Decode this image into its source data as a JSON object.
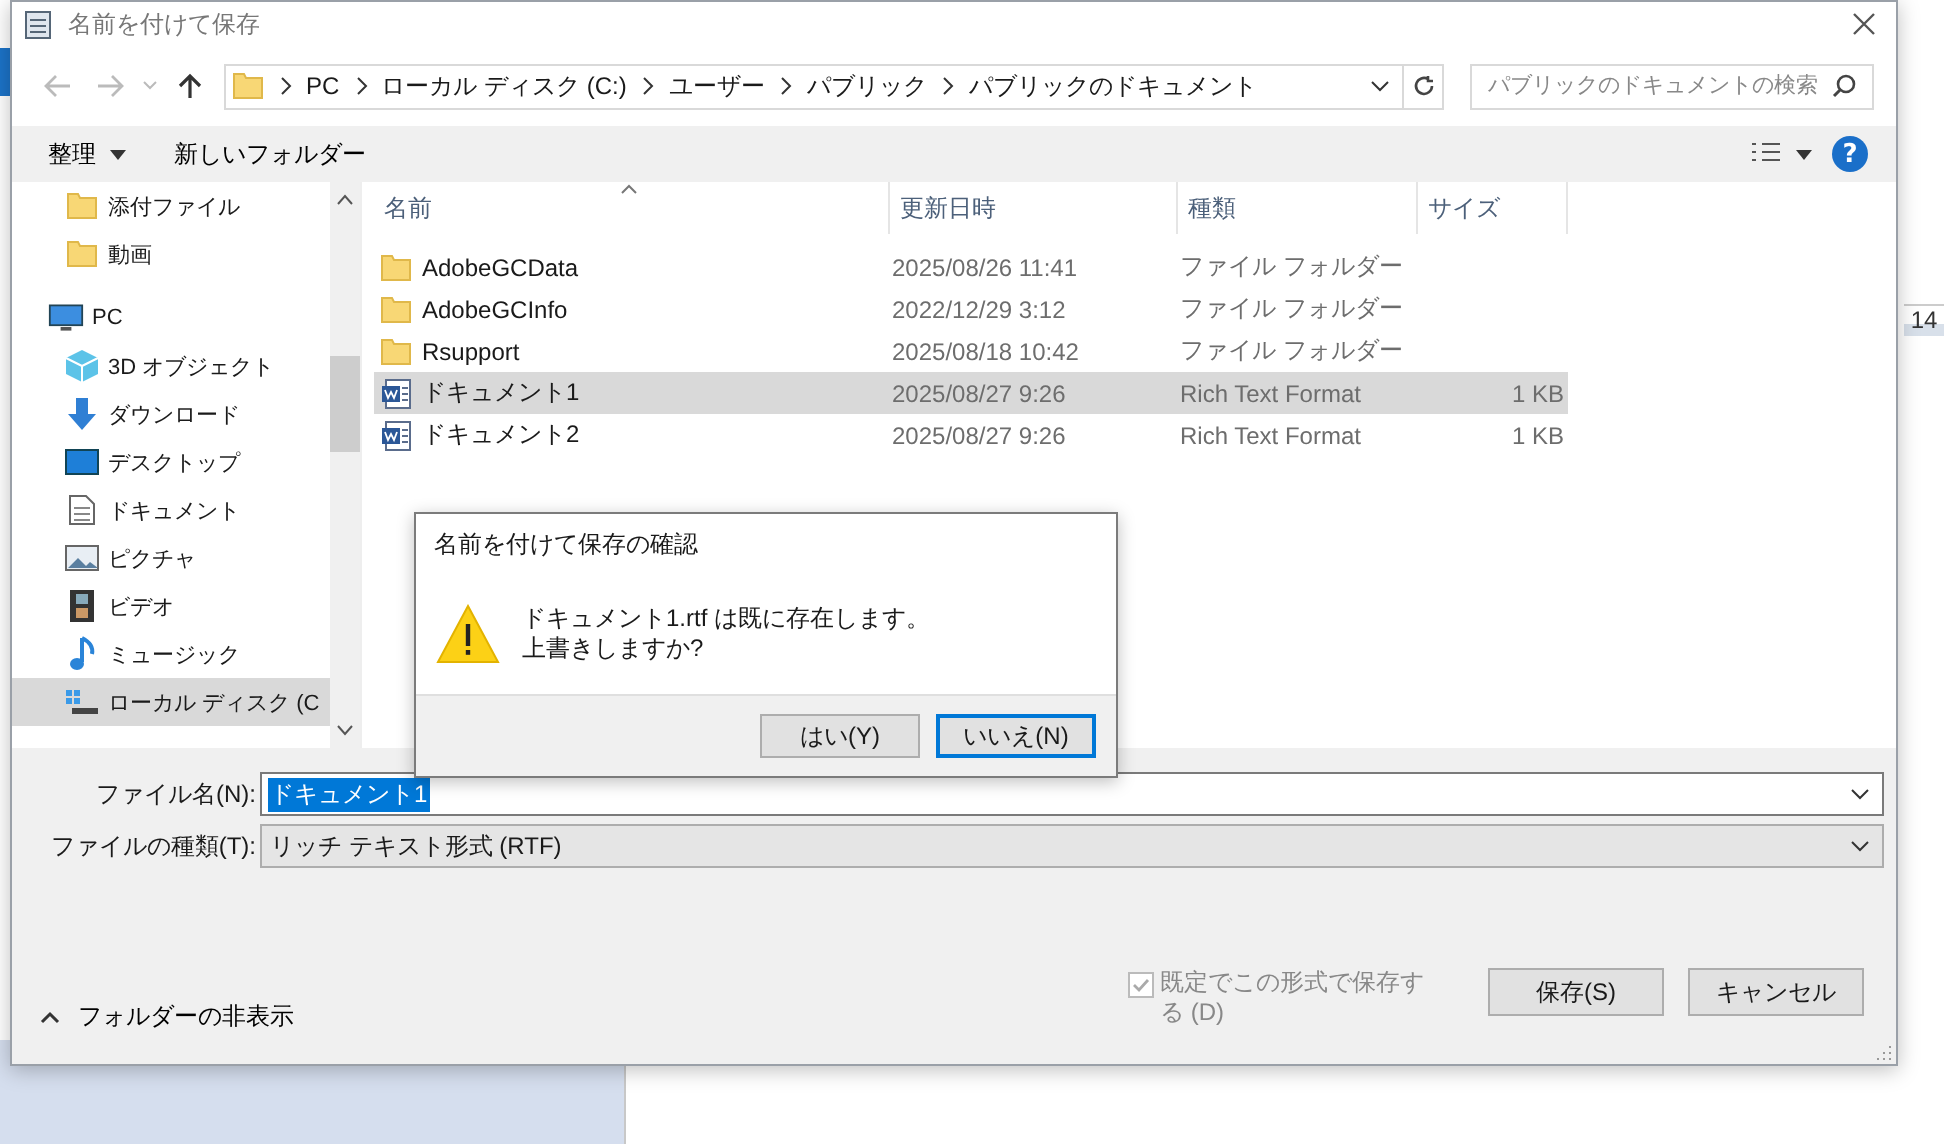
{
  "background": {
    "ruler_label": "14"
  },
  "dialog": {
    "title": "名前を付けて保存"
  },
  "nav": {
    "path": [
      "PC",
      "ローカル ディスク (C:)",
      "ユーザー",
      "パブリック",
      "パブリックのドキュメント"
    ],
    "search": {
      "placeholder": "パブリックのドキュメントの検索"
    }
  },
  "toolbar": {
    "organize": "整理",
    "new_folder": "新しいフォルダー",
    "help": "?"
  },
  "sidebar": {
    "items": [
      {
        "label": "添付ファイル",
        "kind": "folder",
        "selected": false
      },
      {
        "label": "動画",
        "kind": "folder",
        "selected": false
      },
      {
        "label": "PC",
        "kind": "pc",
        "selected": false,
        "children": [
          {
            "label": "3D オブジェクト",
            "kind": "cube",
            "selected": false
          },
          {
            "label": "ダウンロード",
            "kind": "download",
            "selected": false
          },
          {
            "label": "デスクトップ",
            "kind": "desktop",
            "selected": false
          },
          {
            "label": "ドキュメント",
            "kind": "document",
            "selected": false
          },
          {
            "label": "ピクチャ",
            "kind": "picture",
            "selected": false
          },
          {
            "label": "ビデオ",
            "kind": "video",
            "selected": false
          },
          {
            "label": "ミュージック",
            "kind": "music",
            "selected": false
          },
          {
            "label": "ローカル ディスク (C",
            "kind": "drive",
            "selected": true
          }
        ]
      }
    ]
  },
  "table": {
    "columns": [
      "名前",
      "更新日時",
      "種類",
      "サイズ"
    ],
    "rows": [
      {
        "kind": "folder",
        "name": "AdobeGCData",
        "date": "2025/08/26 11:41",
        "type": "ファイル フォルダー",
        "size": "",
        "selected": false
      },
      {
        "kind": "folder",
        "name": "AdobeGCInfo",
        "date": "2022/12/29 3:12",
        "type": "ファイル フォルダー",
        "size": "",
        "selected": false
      },
      {
        "kind": "folder",
        "name": "Rsupport",
        "date": "2025/08/18 10:42",
        "type": "ファイル フォルダー",
        "size": "",
        "selected": false
      },
      {
        "kind": "rtf",
        "name": "ドキュメント1",
        "date": "2025/08/27 9:26",
        "type": "Rich Text Format",
        "size": "1 KB",
        "selected": true
      },
      {
        "kind": "rtf",
        "name": "ドキュメント2",
        "date": "2025/08/27 9:26",
        "type": "Rich Text Format",
        "size": "1 KB",
        "selected": false
      }
    ]
  },
  "form": {
    "file_name": {
      "label": "ファイル名(N):",
      "value": "ドキュメント1",
      "value_selected": true
    },
    "file_type": {
      "label": "ファイルの種類(T):",
      "value": "リッチ テキスト形式 (RTF)"
    },
    "hide_folders": "フォルダーの非表示",
    "default_format": {
      "label": "既定でこの形式で保存する (D)",
      "checked": true,
      "disabled": true
    },
    "buttons": [
      "保存(S)",
      "キャンセル"
    ]
  },
  "confirm": {
    "title": "名前を付けて保存の確認",
    "message": [
      "ドキュメント1.rtf は既に存在します。",
      "上書きしますか?"
    ],
    "buttons": [
      {
        "label": "はい(Y)",
        "selected": false
      },
      {
        "label": "いいえ(N)",
        "selected": true
      }
    ]
  }
}
